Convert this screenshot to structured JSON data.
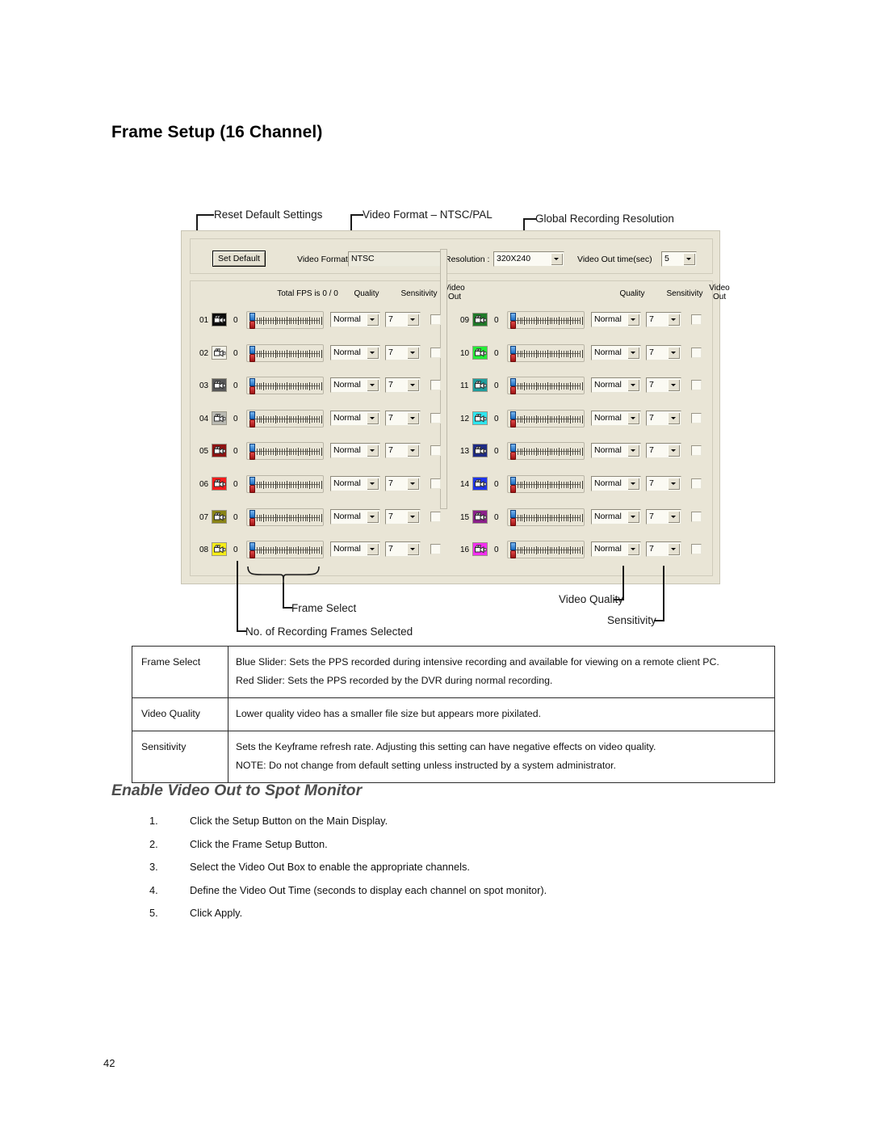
{
  "page": {
    "title": "Frame Setup (16 Channel)",
    "number": "42"
  },
  "callouts": {
    "reset_default": "Reset Default Settings",
    "video_format": "Video Format – NTSC/PAL",
    "global_resolution": "Global Recording Resolution",
    "frame_select": "Frame Select",
    "num_recording_frames": "No. of Recording Frames Selected",
    "video_quality": "Video Quality",
    "sensitivity": "Sensitivity"
  },
  "dialog": {
    "toolbar": {
      "set_default_label": "Set Default",
      "video_format_label": "Video Format :",
      "video_format_value": "NTSC",
      "resolution_label": "Resolution :",
      "resolution_value": "320X240",
      "video_out_time_label": "Video Out time(sec)",
      "video_out_time_value": "5"
    },
    "headers": {
      "total_fps": "Total FPS is 0 / 0",
      "quality": "Quality",
      "sensitivity": "Sensitivity",
      "video_out": "Video Out"
    },
    "channels": [
      {
        "num": "01",
        "fps": "0",
        "quality": "Normal",
        "sensitivity": "7",
        "video_out": false,
        "color": "#0b0b0b"
      },
      {
        "num": "02",
        "fps": "0",
        "quality": "Normal",
        "sensitivity": "7",
        "video_out": false,
        "color": "#f4f3ea"
      },
      {
        "num": "03",
        "fps": "0",
        "quality": "Normal",
        "sensitivity": "7",
        "video_out": false,
        "color": "#585858"
      },
      {
        "num": "04",
        "fps": "0",
        "quality": "Normal",
        "sensitivity": "7",
        "video_out": false,
        "color": "#b9b9b2"
      },
      {
        "num": "05",
        "fps": "0",
        "quality": "Normal",
        "sensitivity": "7",
        "video_out": false,
        "color": "#8f1111"
      },
      {
        "num": "06",
        "fps": "0",
        "quality": "Normal",
        "sensitivity": "7",
        "video_out": false,
        "color": "#f81c1c"
      },
      {
        "num": "07",
        "fps": "0",
        "quality": "Normal",
        "sensitivity": "7",
        "video_out": false,
        "color": "#8a8415"
      },
      {
        "num": "08",
        "fps": "0",
        "quality": "Normal",
        "sensitivity": "7",
        "video_out": false,
        "color": "#f5ec18"
      },
      {
        "num": "09",
        "fps": "0",
        "quality": "Normal",
        "sensitivity": "7",
        "video_out": false,
        "color": "#1f7a28"
      },
      {
        "num": "10",
        "fps": "0",
        "quality": "Normal",
        "sensitivity": "7",
        "video_out": false,
        "color": "#24ef37"
      },
      {
        "num": "11",
        "fps": "0",
        "quality": "Normal",
        "sensitivity": "7",
        "video_out": false,
        "color": "#1f9d9d"
      },
      {
        "num": "12",
        "fps": "0",
        "quality": "Normal",
        "sensitivity": "7",
        "video_out": false,
        "color": "#2ee6ef"
      },
      {
        "num": "13",
        "fps": "0",
        "quality": "Normal",
        "sensitivity": "7",
        "video_out": false,
        "color": "#1e2a86"
      },
      {
        "num": "14",
        "fps": "0",
        "quality": "Normal",
        "sensitivity": "7",
        "video_out": false,
        "color": "#1f35ee"
      },
      {
        "num": "15",
        "fps": "0",
        "quality": "Normal",
        "sensitivity": "7",
        "video_out": false,
        "color": "#8b1f8b"
      },
      {
        "num": "16",
        "fps": "0",
        "quality": "Normal",
        "sensitivity": "7",
        "video_out": false,
        "color": "#f42ef0"
      }
    ]
  },
  "description_table": [
    {
      "term": "Frame Select",
      "lines": [
        "Blue Slider: Sets the PPS recorded during intensive recording and available for viewing on a remote client PC.",
        "Red Slider: Sets the PPS recorded by the DVR during normal recording."
      ]
    },
    {
      "term": "Video Quality",
      "lines": [
        "Lower quality video has a smaller file size but appears more pixilated."
      ]
    },
    {
      "term": "Sensitivity",
      "lines": [
        "Sets the Keyframe refresh rate.  Adjusting this setting can have negative effects on video quality.",
        "NOTE:  Do not change from default setting unless instructed by a system administrator."
      ]
    }
  ],
  "section": {
    "heading": "Enable Video Out to Spot Monitor",
    "steps": [
      {
        "num": "1.",
        "text": "Click the Setup Button on the Main Display."
      },
      {
        "num": "2.",
        "text": "Click the Frame Setup Button."
      },
      {
        "num": "3.",
        "text": "Select the Video Out Box to enable the appropriate channels."
      },
      {
        "num": "4.",
        "text": "Define the Video Out Time (seconds to display each channel on spot monitor)."
      },
      {
        "num": "5.",
        "text": "Click Apply."
      }
    ]
  }
}
